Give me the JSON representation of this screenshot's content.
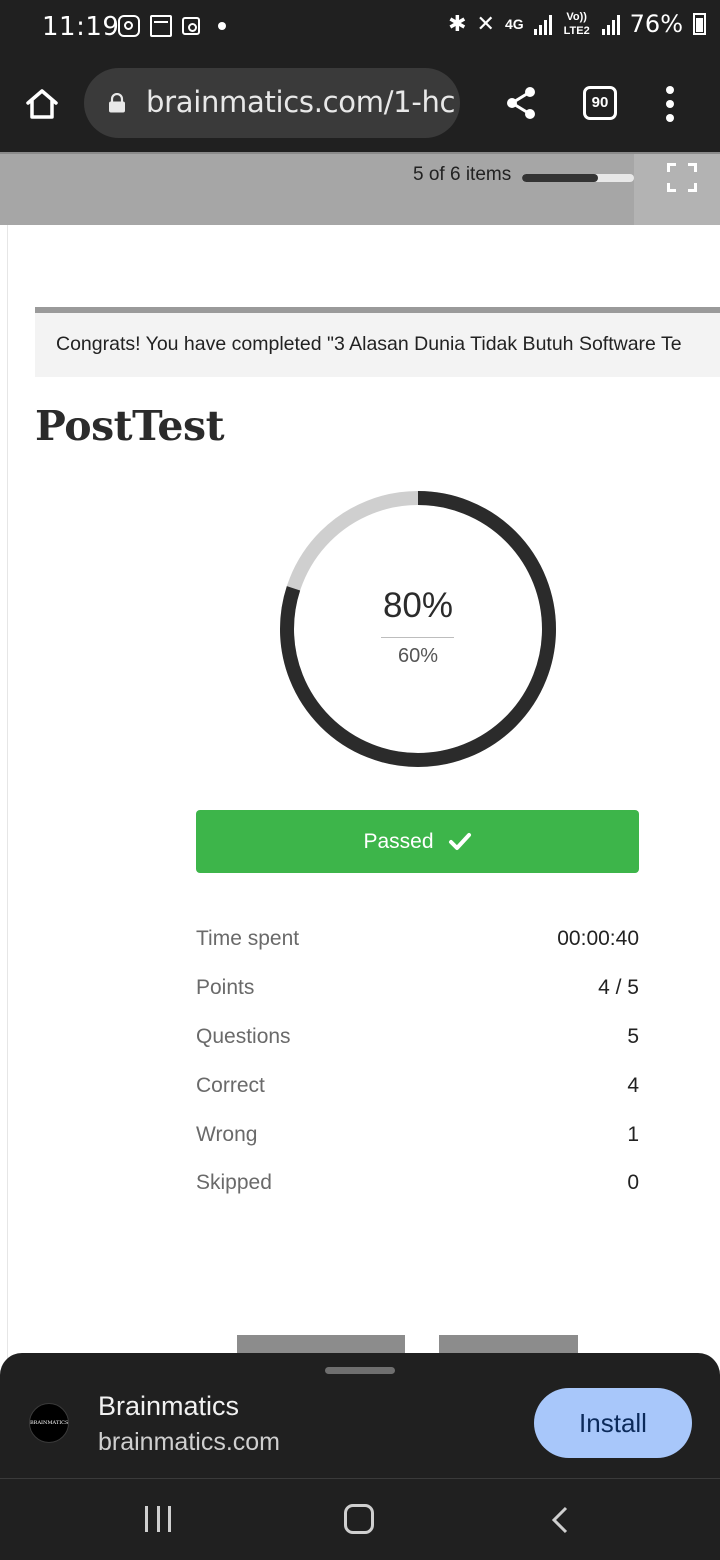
{
  "status_bar": {
    "time": "11:19",
    "network_label": "4G",
    "lte_label": "Vo)) LTE2",
    "battery": "76%"
  },
  "browser": {
    "url": "brainmatics.com/1-hc",
    "tab_count": "90"
  },
  "lesson": {
    "items_label": "5 of 6 items",
    "progress_fraction": 0.68
  },
  "content": {
    "congrats": "Congrats! You have completed \"3 Alasan Dunia Tidak Butuh Software Te",
    "title": "PostTest",
    "score": "80%",
    "score_fraction": 0.8,
    "passing": "60%",
    "result": "Passed",
    "stats": [
      {
        "label": "Time spent",
        "value": "00:00:40"
      },
      {
        "label": "Points",
        "value": "4 / 5"
      },
      {
        "label": "Questions",
        "value": "5"
      },
      {
        "label": "Correct",
        "value": "4"
      },
      {
        "label": "Wrong",
        "value": "1"
      },
      {
        "label": "Skipped",
        "value": "0"
      }
    ]
  },
  "install_prompt": {
    "app_name": "Brainmatics",
    "domain": "brainmatics.com",
    "logo_text": "BRAINMATICS",
    "button": "Install"
  },
  "colors": {
    "passed": "#3db54a",
    "install_button": "#a8c7fa",
    "ring_progress": "#2b2b2b",
    "ring_track": "#cfcfcf"
  }
}
